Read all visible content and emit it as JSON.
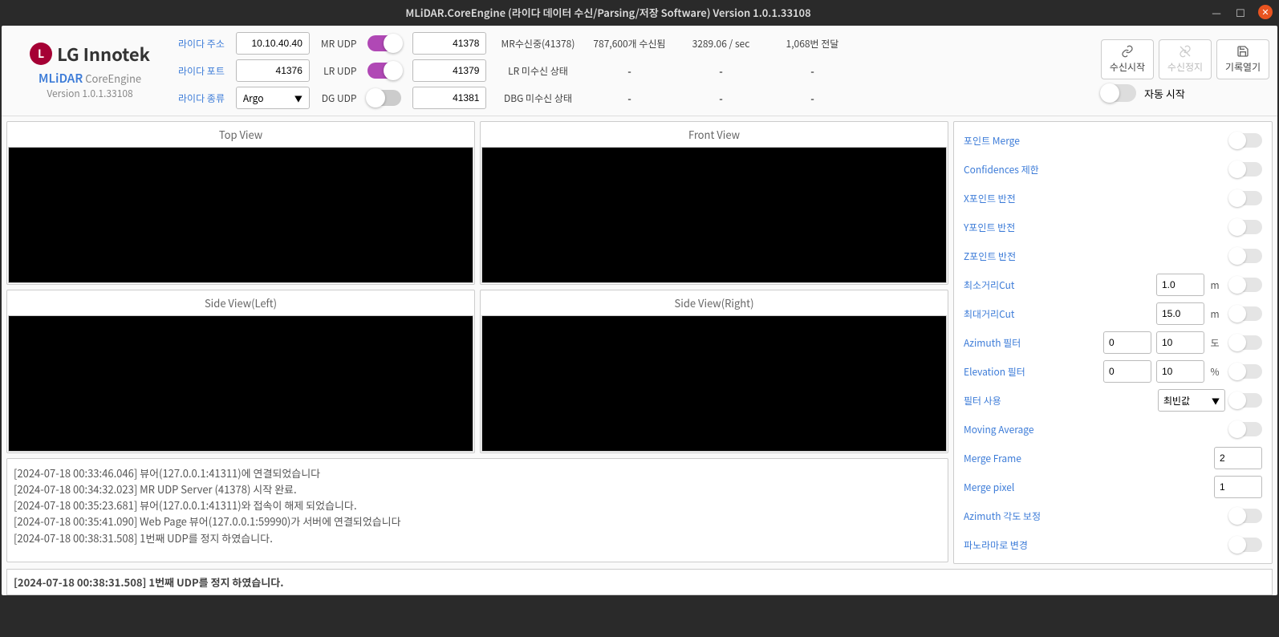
{
  "window": {
    "title": "MLiDAR.CoreEngine (라이다 데이터 수신/Parsing/저장 Software) Version 1.0.1.33108"
  },
  "logo": {
    "brand": "LG Innotek",
    "product": "MLiDAR",
    "product2": "CoreEngine",
    "version": "Version 1.0.1.33108"
  },
  "cfg": {
    "addr_label": "라이다 주소",
    "addr": "10.10.40.40",
    "port_label": "라이다 포트",
    "port": "41376",
    "type_label": "라이다 종류",
    "type": "Argo",
    "mr_label": "MR UDP",
    "mr_port": "41378",
    "lr_label": "LR UDP",
    "lr_port": "41379",
    "dg_label": "DG UDP",
    "dg_port": "41381"
  },
  "status": {
    "mr_status": "MR수신중(41378)",
    "mr_count": "787,600개 수신됨",
    "mr_rate": "3289.06 / sec",
    "mr_fwd": "1,068번 전달",
    "lr_status": "LR 미수신 상태",
    "dg_status": "DBG 미수신 상태",
    "dash": "-"
  },
  "buttons": {
    "start": "수신시작",
    "stop": "수신정지",
    "open": "기록열기",
    "auto": "자동 시작"
  },
  "views": {
    "top": "Top View",
    "front": "Front View",
    "left": "Side View(Left)",
    "right": "Side View(Right)"
  },
  "log": [
    "[2024-07-18 00:33:46.046] 뷰어(127.0.0.1:41311)에 연결되었습니다",
    "[2024-07-18 00:34:32.023] MR UDP Server (41378)  시작 완료.",
    "[2024-07-18 00:35:23.681] 뷰어(127.0.0.1:41311)와 접속이 해제 되었습니다.",
    "[2024-07-18 00:35:41.090] Web Page 뷰어(127.0.0.1:59990)가 서버에 연결되었습니다",
    "[2024-07-18 00:38:31.508] 1번째 UDP를 정지 하였습니다."
  ],
  "settings": {
    "point_merge": "포인트 Merge",
    "conf_limit": "Confidences 제한",
    "x_inv": "X포인트 반전",
    "y_inv": "Y포인트 반전",
    "z_inv": "Z포인트 반전",
    "min_cut": "최소거리Cut",
    "min_cut_v": "1.0",
    "max_cut": "최대거리Cut",
    "max_cut_v": "15.0",
    "unit_m": "m",
    "az_filter": "Azimuth 필터",
    "az_from": "0",
    "az_to": "10",
    "unit_deg": "도",
    "el_filter": "Elevation 필터",
    "el_from": "0",
    "el_to": "10",
    "unit_pct": "%",
    "filter_use": "필터 사용",
    "filter_mode": "최빈값",
    "moving_avg": "Moving Average",
    "merge_frame": "Merge Frame",
    "merge_frame_v": "2",
    "merge_pixel": "Merge pixel",
    "merge_pixel_v": "1",
    "az_angle": "Azimuth 각도 보정",
    "panorama": "파노라마로 변경"
  },
  "statusbar": "[2024-07-18 00:38:31.508] 1번째 UDP를 정지 하였습니다."
}
